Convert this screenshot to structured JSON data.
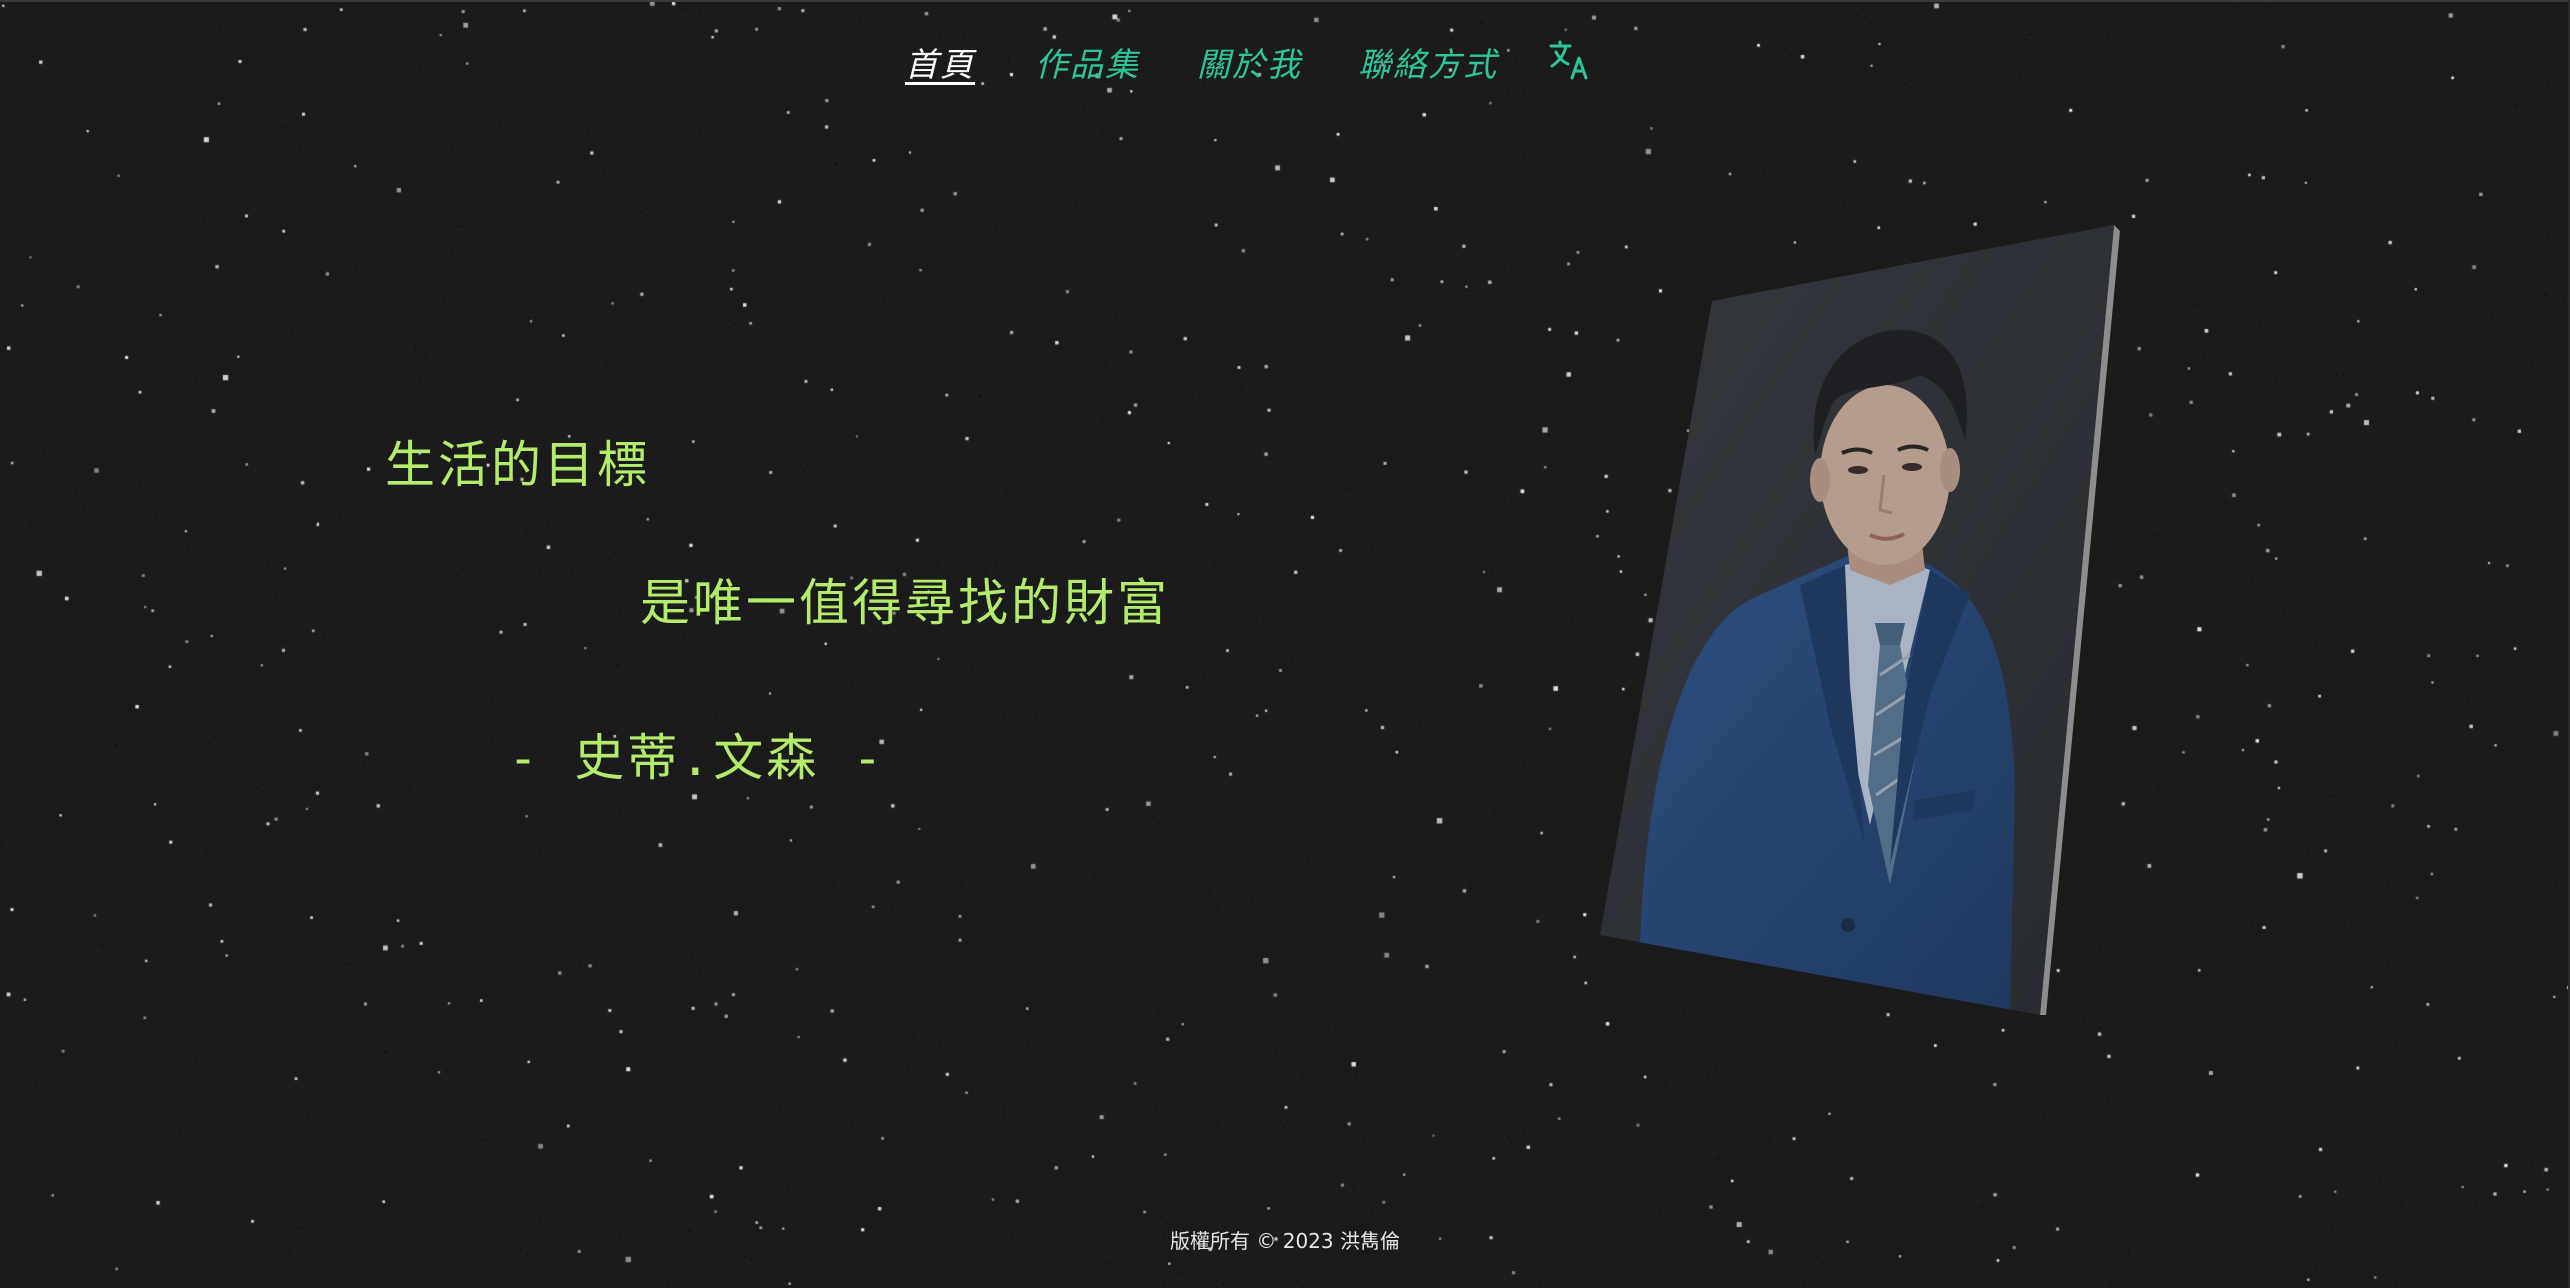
{
  "nav": {
    "items": [
      {
        "label": "首頁",
        "active": true
      },
      {
        "label": "作品集",
        "active": false
      },
      {
        "label": "關於我",
        "active": false
      },
      {
        "label": "聯絡方式",
        "active": false
      }
    ],
    "translate_icon": "translate-icon"
  },
  "quote": {
    "line1": "生活的目標",
    "line2": "是唯一值得尋找的財富",
    "attribution": "- 史蒂.文森 -"
  },
  "profile_photo": {
    "alt_icon": "profile-photo"
  },
  "footer": {
    "copyright": "版權所有 © 2023 洪雋倫"
  },
  "colors": {
    "background": "#1b1b1b",
    "nav_link": "#2ec59a",
    "nav_active": "#ffffff",
    "quote_text": "#b3ec6a",
    "footer_text": "#e6e6e6"
  }
}
